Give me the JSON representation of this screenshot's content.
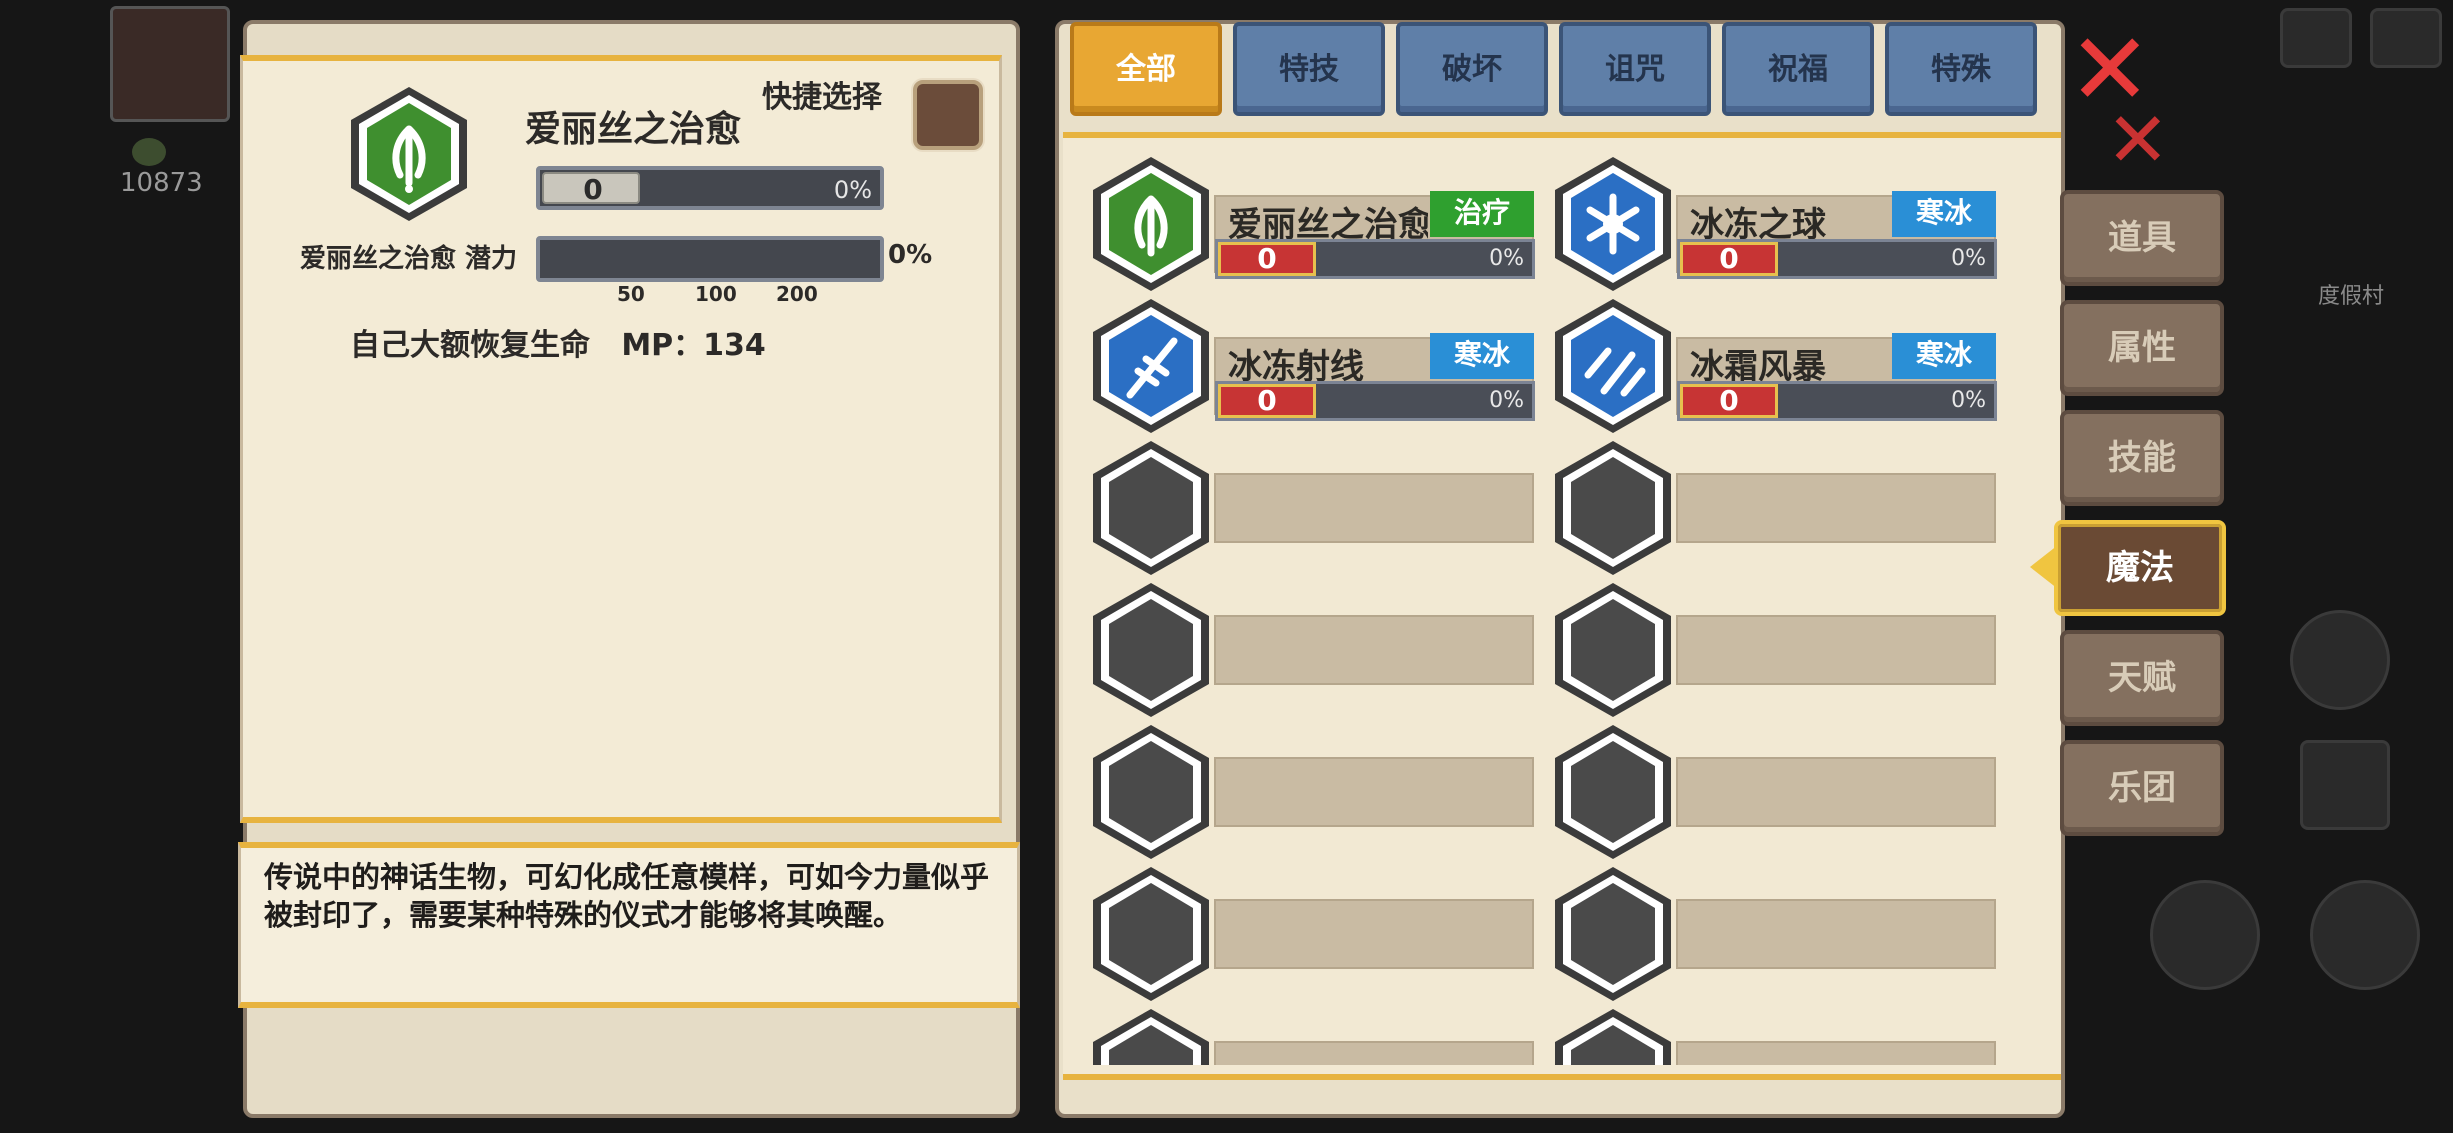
{
  "background": {
    "gold_value": "10873",
    "village_label": "度假村"
  },
  "detail": {
    "skill_name": "爱丽丝之治愈",
    "quick_select_label": "快捷选择",
    "level_value": "0",
    "level_pct": "0%",
    "potential_label": "爱丽丝之治愈 潜力",
    "potential_pct": "0%",
    "potential_ticks": [
      "50",
      "100",
      "200"
    ],
    "effect_text": "自己大额恢复生命   MP：134",
    "lore_text": "传说中的神话生物，可幻化成任意模样，可如今力量似乎被封印了，需要某种特殊的仪式才能够将其唤醒。"
  },
  "category_tabs": [
    "全部",
    "特技",
    "破坏",
    "诅咒",
    "祝福",
    "特殊"
  ],
  "active_category": "全部",
  "skills": [
    {
      "name": "爱丽丝之治愈",
      "tag": "治疗",
      "tag_color": "#2fa02f",
      "level": "0",
      "pct": "0%",
      "icon": "leaf-heal-icon",
      "icon_color": "#3f8f2f"
    },
    {
      "name": "冰冻之球",
      "tag": "寒冰",
      "tag_color": "#2a8fd6",
      "level": "0",
      "pct": "0%",
      "icon": "snowflake-icon",
      "icon_color": "#2b6fc4"
    },
    {
      "name": "冰冻射线",
      "tag": "寒冰",
      "tag_color": "#2a8fd6",
      "level": "0",
      "pct": "0%",
      "icon": "ice-ray-icon",
      "icon_color": "#2b6fc4"
    },
    {
      "name": "冰霜风暴",
      "tag": "寒冰",
      "tag_color": "#2a8fd6",
      "level": "0",
      "pct": "0%",
      "icon": "frost-storm-icon",
      "icon_color": "#2b6fc4"
    }
  ],
  "side_tabs": [
    "道具",
    "属性",
    "技能",
    "魔法",
    "天赋",
    "乐团"
  ],
  "active_side_tab": "魔法"
}
